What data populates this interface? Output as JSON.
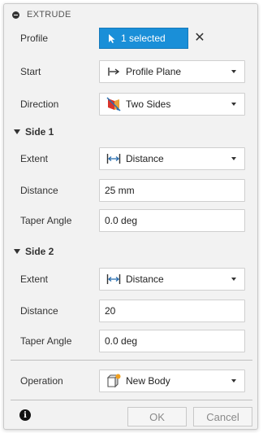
{
  "dialog": {
    "title": "EXTRUDE"
  },
  "profile": {
    "label": "Profile",
    "selection": "1 selected",
    "clear_glyph": "✕"
  },
  "start": {
    "label": "Start",
    "value": "Profile Plane",
    "icon": "start-arrow-icon"
  },
  "direction": {
    "label": "Direction",
    "value": "Two Sides",
    "icon": "two-sides-icon"
  },
  "side1": {
    "title": "Side 1",
    "extent_label": "Extent",
    "extent_value": "Distance",
    "distance_label": "Distance",
    "distance_value": "25 mm",
    "taper_label": "Taper Angle",
    "taper_value": "0.0 deg"
  },
  "side2": {
    "title": "Side 2",
    "extent_label": "Extent",
    "extent_value": "Distance",
    "distance_label": "Distance",
    "distance_value": "20",
    "taper_label": "Taper Angle",
    "taper_value": "0.0 deg"
  },
  "operation": {
    "label": "Operation",
    "value": "New Body",
    "icon": "new-body-icon"
  },
  "footer": {
    "info_glyph": "i",
    "ok_label": "OK",
    "cancel_label": "Cancel"
  },
  "colors": {
    "selection_blue": "#1a8fd8",
    "panel_bg": "#f2f2f2",
    "direction_red": "#d9342b",
    "operation_orange": "#f0a020"
  }
}
